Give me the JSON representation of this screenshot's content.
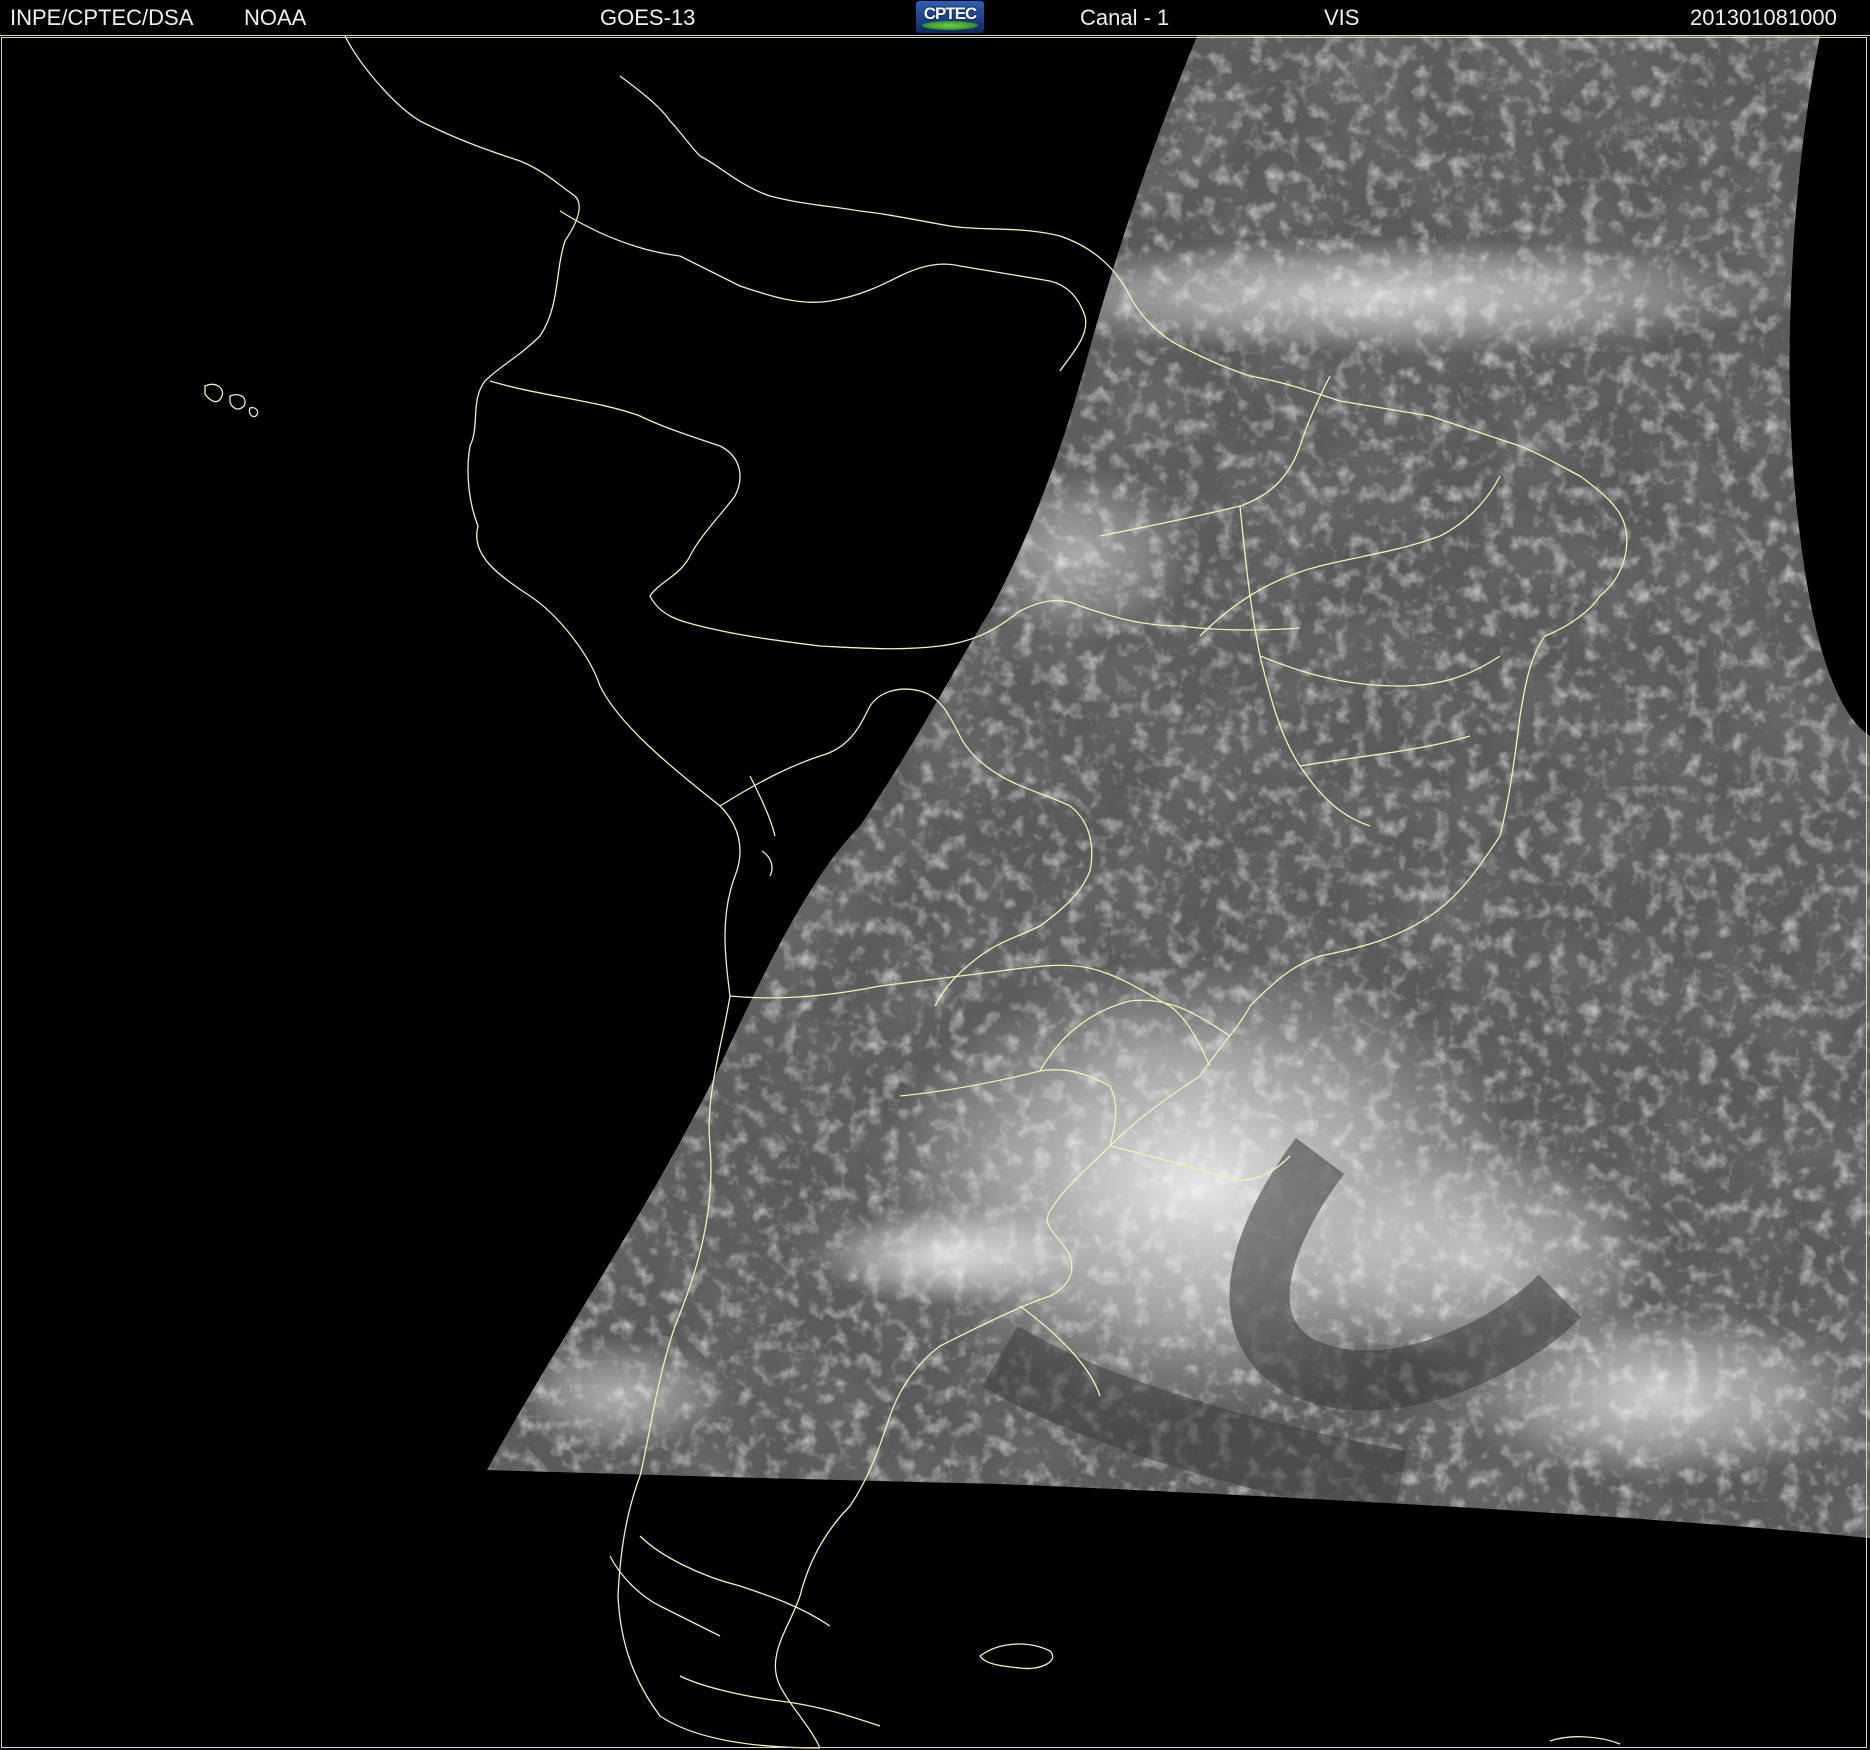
{
  "header": {
    "institution": "INPE/CPTEC/DSA",
    "agency": "NOAA",
    "satellite": "GOES-13",
    "logo_text": "CPTEC",
    "channel": "Canal - 1",
    "band": "VIS",
    "timestamp": "201301081000"
  },
  "map": {
    "coastline_color": "#f2f2b4",
    "background_color": "#000000"
  }
}
